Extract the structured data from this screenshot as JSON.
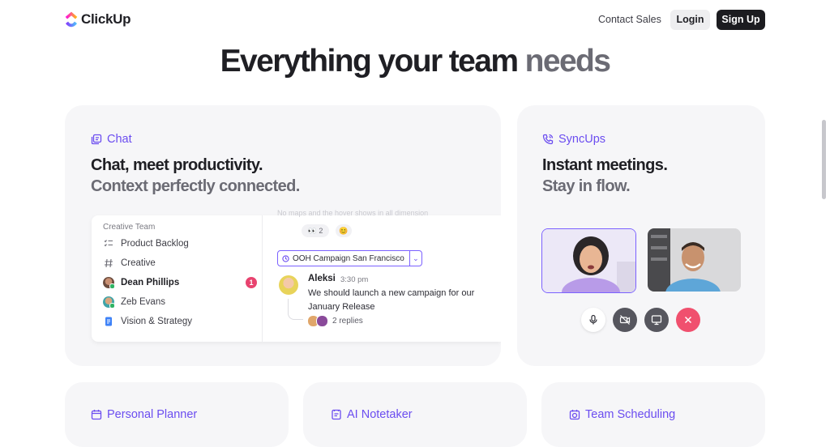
{
  "header": {
    "brand": "ClickUp",
    "contact_sales": "Contact Sales",
    "login": "Login",
    "signup": "Sign Up"
  },
  "hero": {
    "title_dark": "Everything your team",
    "title_light": "needs"
  },
  "chat_card": {
    "label": "Chat",
    "heading_1": "Chat, meet productivity.",
    "heading_2": "Context perfectly connected.",
    "sidebar": {
      "title": "Creative Team",
      "items": [
        {
          "label": "Product Backlog",
          "icon": "checklist-icon"
        },
        {
          "label": "Creative",
          "icon": "hash-icon"
        },
        {
          "label": "Dean Phillips",
          "icon": "avatar",
          "badge": "1"
        },
        {
          "label": "Zeb Evans",
          "icon": "avatar"
        },
        {
          "label": "Vision & Strategy",
          "icon": "doc-icon"
        }
      ]
    },
    "faded_text": "No maps and the hover shows in all dimension",
    "reactions": [
      "👀 2",
      "😊"
    ],
    "channel_tag": "OOH Campaign San Francisco",
    "message": {
      "author": "Aleksi",
      "time": "3:30 pm",
      "text": "We should launch a new campaign for our January Release",
      "replies": "2 replies"
    }
  },
  "syncups_card": {
    "label": "SyncUps",
    "heading_1": "Instant meetings.",
    "heading_2": "Stay in flow.",
    "controls": [
      "microphone-icon",
      "camera-off-icon",
      "screen-share-icon",
      "close-icon"
    ]
  },
  "bottom_cards": {
    "planner": "Personal Planner",
    "notetaker": "AI Notetaker",
    "scheduling": "Team Scheduling"
  },
  "colors": {
    "accent": "#6b4df0",
    "badge": "#e8436f",
    "end_call": "#f0506e",
    "card_bg": "#f6f6f8"
  }
}
